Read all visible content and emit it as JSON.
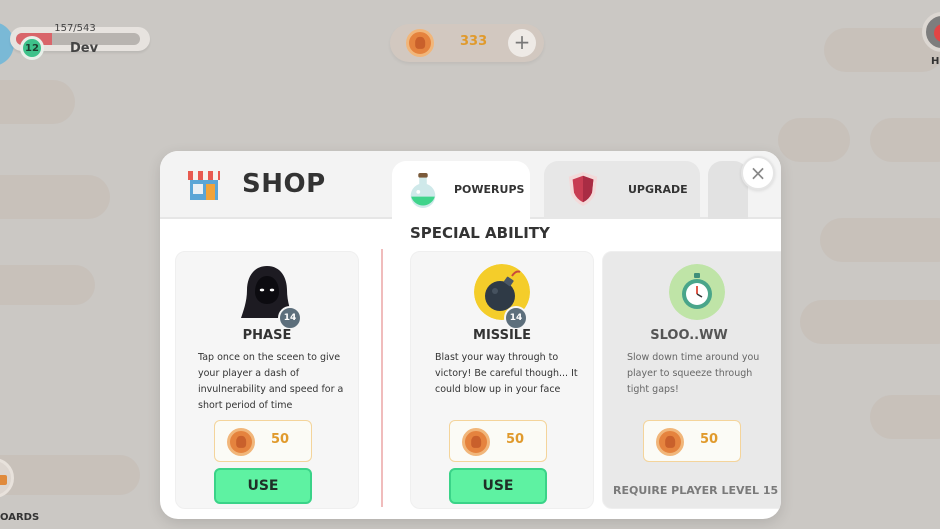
{
  "hud": {
    "xp_text": "157/543",
    "xp_progress": 0.29,
    "level": "12",
    "player_name": "Dev",
    "coins": "333",
    "add_label": "+",
    "right_label": "H",
    "bottom_left_label": "OARDS"
  },
  "shop": {
    "title": "SHOP",
    "close_label": "×",
    "tabs": [
      {
        "label": "POWERUPS",
        "icon": "potion-icon",
        "active": true
      },
      {
        "label": "UPGRADE",
        "icon": "shield-icon",
        "active": false
      }
    ],
    "section_title": "SPECIAL ABILITY",
    "cards": [
      {
        "name": "PHASE",
        "icon": "hooded-figure-icon",
        "level": "14",
        "description": "Tap once on the sceen to give your player a dash of invulnerability and speed for a short period of time",
        "price": "50",
        "button": "USE",
        "locked": false
      },
      {
        "name": "MISSILE",
        "icon": "bomb-icon",
        "level": "14",
        "description": "Blast your way through to victory! Be careful though... It could blow up in your face",
        "price": "50",
        "button": "USE",
        "locked": false
      },
      {
        "name": "SLOO..WW",
        "icon": "stopwatch-icon",
        "description": "Slow down time around you player to squeeze through tight gaps!",
        "price": "50",
        "requirement": "REQUIRE PLAYER LEVEL 15",
        "locked": true
      }
    ]
  },
  "colors": {
    "background": "#cbc8c4",
    "accent_coin": "#e09a2c",
    "use_button": "#5ef2a2",
    "level_badge": "#3ec18a",
    "xp_fill": "#d9656a"
  }
}
